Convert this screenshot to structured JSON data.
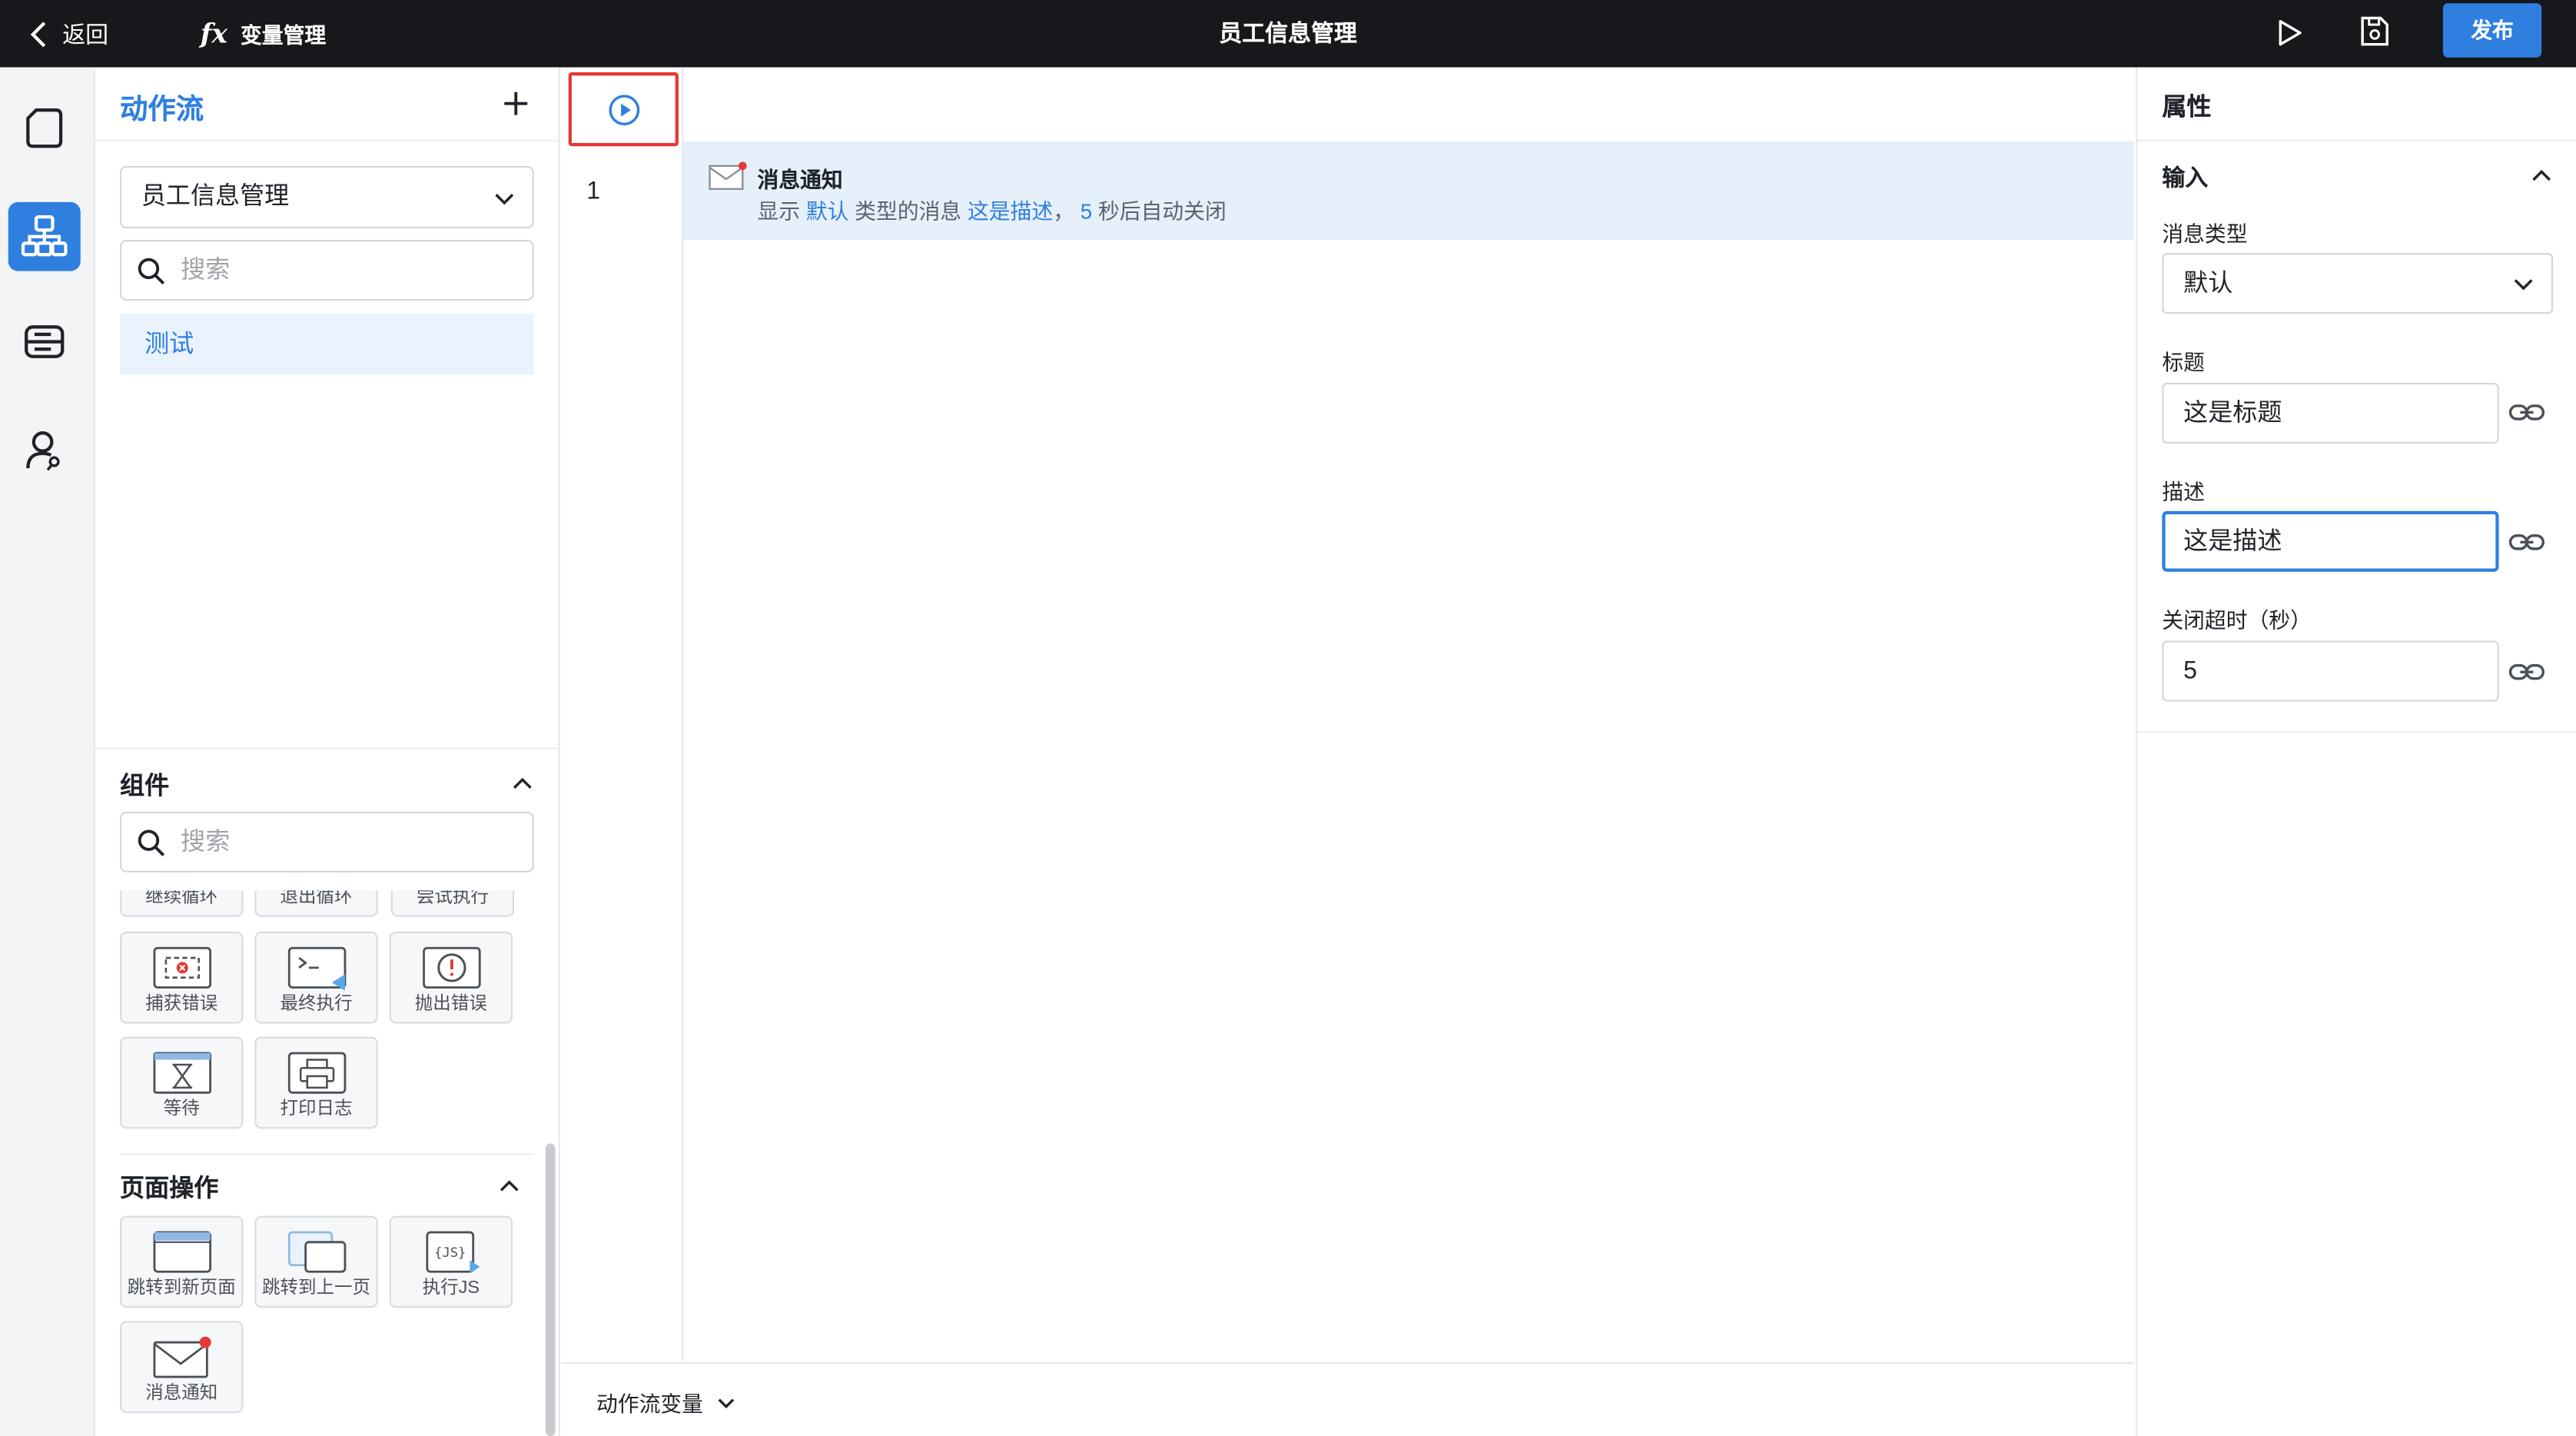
{
  "topbar": {
    "back_label": "返回",
    "fx_glyph": "fx",
    "variable_manager_label": "变量管理",
    "page_title": "员工信息管理",
    "publish_label": "发布",
    "brand_color": "#2f7fe0"
  },
  "rail": {
    "items": [
      {
        "icon": "page-icon",
        "active": false
      },
      {
        "icon": "actionflow-icon",
        "active": true
      },
      {
        "icon": "data-source-icon",
        "active": false
      },
      {
        "icon": "user-permission-icon",
        "active": false
      }
    ]
  },
  "actionflow_panel": {
    "title": "动作流",
    "page_select_value": "员工信息管理",
    "search_placeholder": "搜索",
    "flows": [
      {
        "label": "测试",
        "selected": true
      }
    ]
  },
  "components": {
    "title": "组件",
    "search_placeholder": "搜索",
    "partial_row": [
      "继续循环",
      "退出循环",
      "尝试执行"
    ],
    "tiles": [
      {
        "label": "捕获错误",
        "icon": "catch-error-icon"
      },
      {
        "label": "最终执行",
        "icon": "finally-icon"
      },
      {
        "label": "抛出错误",
        "icon": "throw-error-icon"
      },
      {
        "label": "等待",
        "icon": "wait-icon"
      },
      {
        "label": "打印日志",
        "icon": "print-log-icon"
      }
    ]
  },
  "page_operations": {
    "title": "页面操作",
    "tiles": [
      {
        "label": "跳转到新页面",
        "icon": "new-page-icon"
      },
      {
        "label": "跳转到上一页",
        "icon": "previous-page-icon"
      },
      {
        "label": "执行JS",
        "icon": "js-icon"
      },
      {
        "label": "消息通知",
        "icon": "message-icon"
      }
    ]
  },
  "canvas": {
    "line_number": "1",
    "step": {
      "name": "消息通知",
      "desc_prefix": "显示",
      "type_value": "默认",
      "desc_middle": "类型的消息",
      "desc_value": "这是描述",
      "comma": "，",
      "timeout_value": "5",
      "desc_suffix": "秒后自动关闭"
    },
    "variables_label": "动作流变量"
  },
  "properties": {
    "title": "属性",
    "section_title": "输入",
    "message_type_label": "消息类型",
    "message_type_value": "默认",
    "title_label": "标题",
    "title_value": "这是标题",
    "description_label": "描述",
    "description_value": "这是描述",
    "timeout_label": "关闭超时（秒）",
    "timeout_value": "5"
  }
}
